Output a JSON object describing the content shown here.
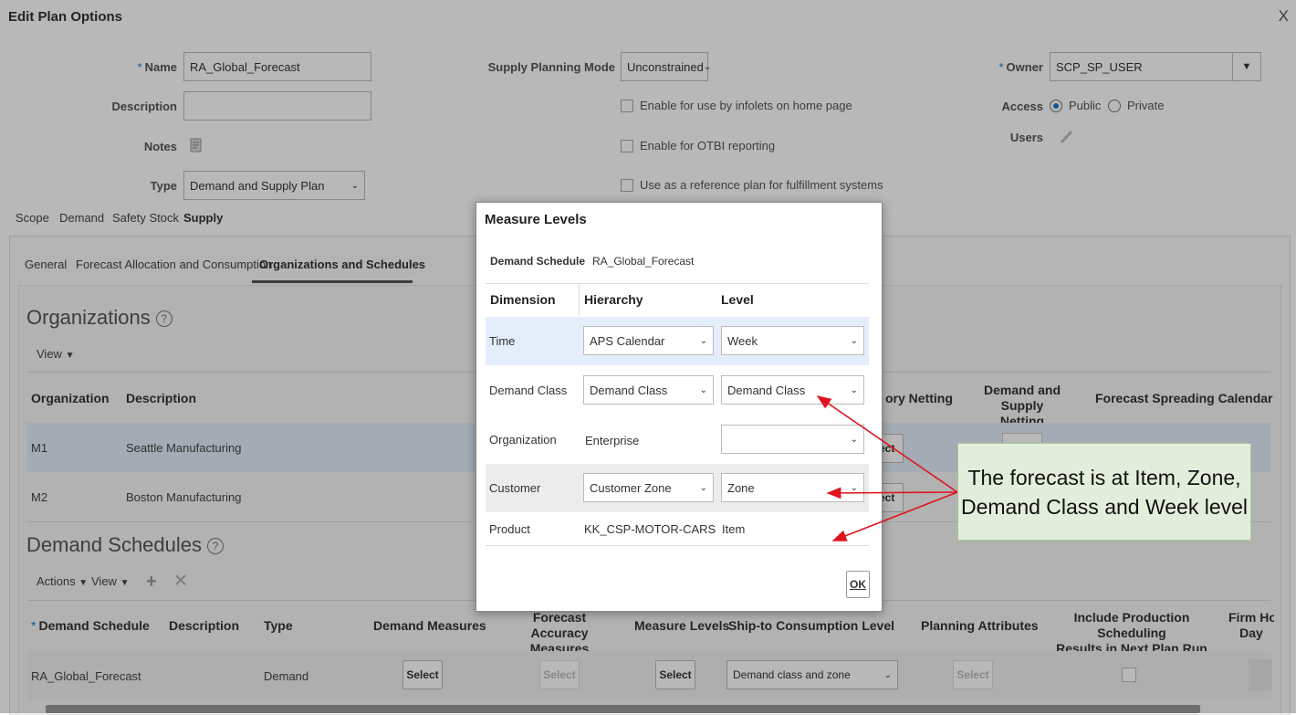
{
  "header": {
    "title": "Edit Plan Options",
    "close": "X"
  },
  "form": {
    "name_label": "Name",
    "name_value": "RA_Global_Forecast",
    "description_label": "Description",
    "description_value": "",
    "notes_label": "Notes",
    "type_label": "Type",
    "type_value": "Demand and Supply Plan",
    "mode_label": "Supply Planning Mode",
    "mode_value": "Unconstrained",
    "chk_infolets": "Enable for use by infolets on home page",
    "chk_otbi": "Enable for OTBI reporting",
    "chk_reference": "Use as a reference plan for fulfillment systems",
    "owner_label": "Owner",
    "owner_value": "SCP_SP_USER",
    "access_label": "Access",
    "access_public": "Public",
    "access_private": "Private",
    "users_label": "Users"
  },
  "tabs": [
    "Scope",
    "Demand",
    "Safety Stock",
    "Supply"
  ],
  "subtabs": [
    "General",
    "Forecast Allocation and Consumption",
    "Organizations and Schedules"
  ],
  "organizations": {
    "title": "Organizations",
    "view": "View",
    "col_org": "Organization",
    "col_desc": "Description",
    "col_inventory_netting": "ory Netting",
    "col_demand_supply_1": "Demand and Supply",
    "col_demand_supply_2": "Netting",
    "col_forecast_spreading": "Forecast Spreading Calendar",
    "rows": [
      {
        "org": "M1",
        "desc": "Seattle Manufacturing",
        "sel": "lect"
      },
      {
        "org": "M2",
        "desc": "Boston Manufacturing",
        "sel": "lect"
      }
    ]
  },
  "demand_schedules": {
    "title": "Demand Schedules",
    "actions": "Actions",
    "view": "View",
    "col_schedule": "Demand Schedule",
    "col_desc": "Description",
    "col_type": "Type",
    "col_measures": "Demand Measures",
    "col_accuracy_1": "Forecast Accuracy",
    "col_accuracy_2": "Measures",
    "col_levels": "Measure Levels",
    "col_shipto": "Ship-to Consumption Level",
    "col_attributes": "Planning Attributes",
    "col_include_1": "Include Production Scheduling",
    "col_include_2": "Results in Next Plan Run",
    "col_firm_1": "Firm Ho",
    "col_firm_2": "Day",
    "row": {
      "schedule": "RA_Global_Forecast",
      "type": "Demand",
      "select": "Select",
      "shipto": "Demand class and zone"
    }
  },
  "dialog": {
    "title": "Measure Levels",
    "schedule_label": "Demand Schedule",
    "schedule_value": "RA_Global_Forecast",
    "headers": {
      "dimension": "Dimension",
      "hierarchy": "Hierarchy",
      "level": "Level"
    },
    "rows": [
      {
        "dimension": "Time",
        "hierarchy": "APS Calendar",
        "level": "Week"
      },
      {
        "dimension": "Demand Class",
        "hierarchy": "Demand Class",
        "level": "Demand Class"
      },
      {
        "dimension": "Organization",
        "hierarchy": "Enterprise",
        "level": ""
      },
      {
        "dimension": "Customer",
        "hierarchy": "Customer Zone",
        "level": "Zone"
      },
      {
        "dimension": "Product",
        "hierarchy": "KK_CSP-MOTOR-CARS",
        "level": "Item"
      }
    ],
    "ok_label": "OK"
  },
  "callout": {
    "text": "The forecast is at Item, Zone, Demand Class and Week level"
  },
  "colors": {
    "accent": "#1a7bd2",
    "arrow": "#e0141e",
    "callout_bg": "#e2eedb",
    "row_highlight": "#e3eefa"
  }
}
